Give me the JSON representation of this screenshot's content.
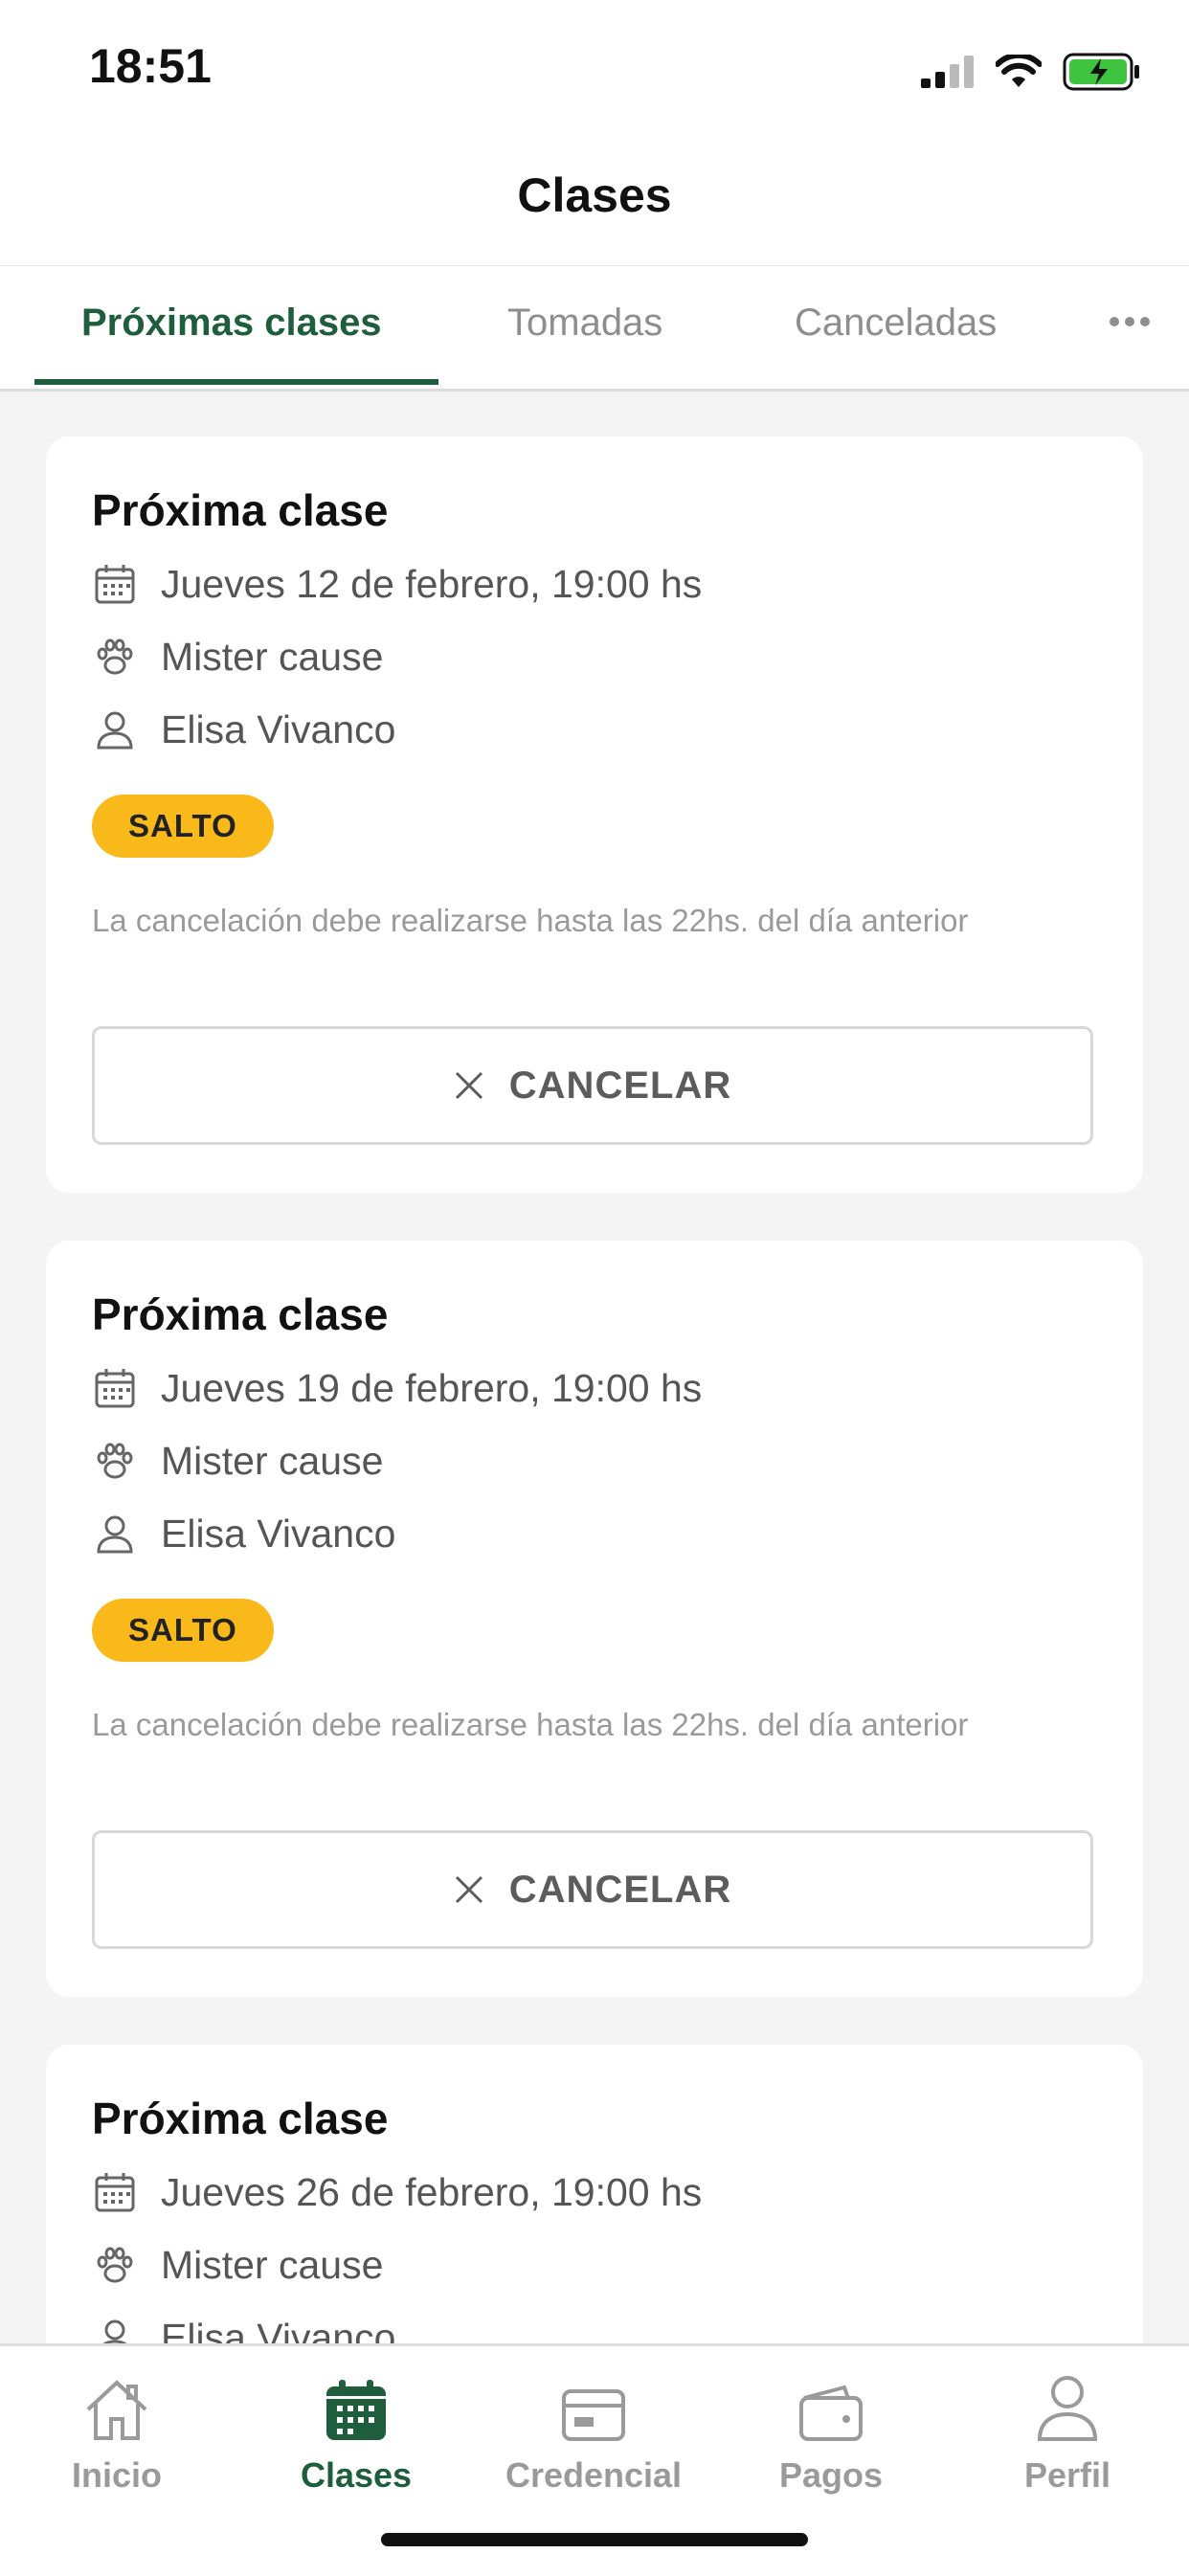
{
  "status_bar": {
    "time": "18:51"
  },
  "header": {
    "title": "Clases"
  },
  "tabs": [
    {
      "label": "Próximas clases",
      "active": true
    },
    {
      "label": "Tomadas",
      "active": false
    },
    {
      "label": "Canceladas",
      "active": false
    }
  ],
  "more_icon": "ellipsis-icon",
  "cards": [
    {
      "title": "Próxima clase",
      "date": "Jueves 12 de febrero, 19:00 hs",
      "horse": "Mister cause",
      "instructor": "Elisa Vivanco",
      "badge": "SALTO",
      "note": "La cancelación debe realizarse hasta las 22hs. del día anterior",
      "cancel_label": "CANCELAR"
    },
    {
      "title": "Próxima clase",
      "date": "Jueves 19 de febrero, 19:00 hs",
      "horse": "Mister cause",
      "instructor": "Elisa Vivanco",
      "badge": "SALTO",
      "note": "La cancelación debe realizarse hasta las 22hs. del día anterior",
      "cancel_label": "CANCELAR"
    },
    {
      "title": "Próxima clase",
      "date": "Jueves 26 de febrero, 19:00 hs",
      "horse": "Mister cause",
      "instructor": "Elisa Vivanco"
    }
  ],
  "bottom_nav": [
    {
      "label": "Inicio",
      "icon": "home-icon",
      "active": false
    },
    {
      "label": "Clases",
      "icon": "calendar-icon",
      "active": true
    },
    {
      "label": "Credencial",
      "icon": "card-icon",
      "active": false
    },
    {
      "label": "Pagos",
      "icon": "wallet-icon",
      "active": false
    },
    {
      "label": "Perfil",
      "icon": "user-icon",
      "active": false
    }
  ],
  "colors": {
    "accent": "#1e5e3d",
    "badge": "#f9b91a",
    "battery": "#3ec43e"
  }
}
